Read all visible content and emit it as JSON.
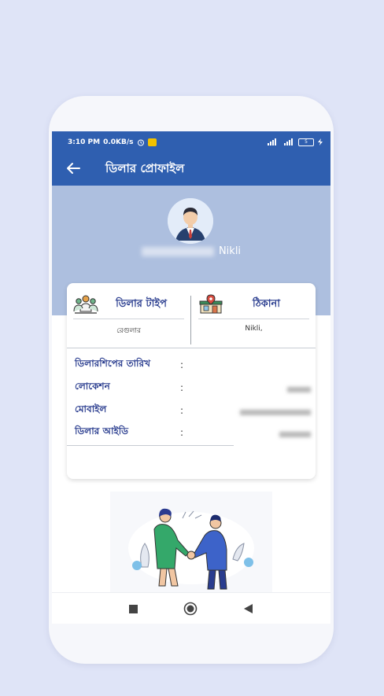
{
  "status_bar": {
    "time": "3:10 PM",
    "speed": "0.0KB/s",
    "battery": "5"
  },
  "app_bar": {
    "title": "ডিলার প্রোফাইল"
  },
  "profile": {
    "location_name": "Nikli"
  },
  "summary": {
    "dealer_type_label": "ডিলার টাইপ",
    "dealer_type_value": "রেগুলার",
    "address_label": "ঠিকানা",
    "address_value": "Nikli,"
  },
  "details": {
    "dealership_date_label": "ডিলারশিপের তারিখ",
    "location_label": "লোকেশন",
    "mobile_label": "মোবাইল",
    "dealer_id_label": "ডিলার আইডি",
    "separator": ":"
  },
  "colors": {
    "primary": "#2f5fb0",
    "hero_bg": "#adbfdf",
    "label_text": "#2a3d8f",
    "page_bg": "#dfe4f7"
  }
}
